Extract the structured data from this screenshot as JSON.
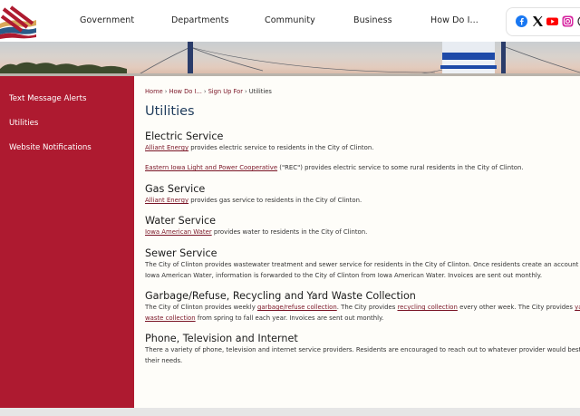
{
  "nav": {
    "items": [
      "Government",
      "Departments",
      "Community",
      "Business",
      "How Do I..."
    ]
  },
  "social": {
    "icons": [
      "facebook-icon",
      "x-icon",
      "youtube-icon",
      "instagram-icon"
    ]
  },
  "colors": {
    "sidebar": "#ae1a30",
    "title": "#1f3c5c",
    "link": "#7a1526"
  },
  "sidebar": {
    "items": [
      "Text Message Alerts",
      "Utilities",
      "Website Notifications"
    ]
  },
  "breadcrumb": {
    "items": [
      "Home",
      "How Do I...",
      "Sign Up For"
    ],
    "separator": "›",
    "current": "Utilities"
  },
  "page": {
    "title": "Utilities"
  },
  "sections": {
    "electric": {
      "heading": "Electric Service",
      "p1_link": "Alliant Energy",
      "p1_text": " provides electric service to residents in the City of Clinton.",
      "p2_link": "Eastern Iowa Light and Power Cooperative",
      "p2_text": " (\"REC\") provides electric service to some rural residents in the City of Clinton."
    },
    "gas": {
      "heading": "Gas Service",
      "link": "Alliant Energy",
      "text": " provides gas service to residents in the City of Clinton."
    },
    "water": {
      "heading": "Water Service",
      "link": "Iowa American Water",
      "text": " provides water to residents in the City of Clinton."
    },
    "sewer": {
      "heading": "Sewer Service",
      "line1": "The City of Clinton provides wastewater treatment and sewer service for residents in the City of Clinton. Once residents create an account with",
      "line2": "Iowa American Water, information is forwarded to the City of Clinton from Iowa American Water. Invoices are sent out monthly."
    },
    "garbage": {
      "heading": "Garbage/Refuse, Recycling and Yard Waste Collection",
      "t1": "The City of Clinton provides weekly ",
      "link1": "garbage/refuse collection",
      "t2": ". The City provides ",
      "link2": "recycling collection",
      "t3": " every other week. The City provides ",
      "link3a": "yard",
      "link3b": "waste collection",
      "t4": " from spring to fall each year. Invoices are sent out monthly."
    },
    "phone": {
      "heading": "Phone, Television and Internet",
      "line1": "There a variety of phone, television and internet service providers. Residents are encouraged to reach out to whatever provider would best meet",
      "line2": "their needs."
    }
  }
}
